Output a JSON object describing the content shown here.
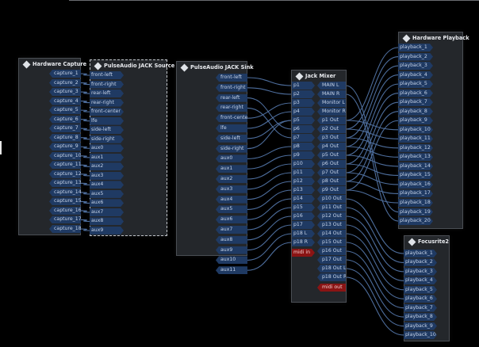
{
  "colors": {
    "port": "#1f3a63",
    "midi_port": "#8a1414",
    "wire": "#4d6d9c",
    "box_bg": "#24272b"
  },
  "boxes": [
    {
      "id": "hwcap",
      "title": "Hardware Capture",
      "icon": "diamond-icon",
      "dashed": false,
      "outs": [
        "capture_1",
        "capture_2",
        "capture_3",
        "capture_4",
        "capture_5",
        "capture_6",
        "capture_7",
        "capture_8",
        "capture_9",
        "capture_10",
        "capture_11",
        "capture_12",
        "capture_13",
        "capture_14",
        "capture_15",
        "capture_16",
        "capture_17",
        "capture_18"
      ],
      "ins": []
    },
    {
      "id": "pasrc",
      "title": "PulseAudio JACK Source",
      "icon": "diamond-icon",
      "dashed": true,
      "ins": [
        "front-left",
        "front-right",
        "rear-left",
        "rear-right",
        "front-center",
        "lfe",
        "side-left",
        "side-right",
        "aux0",
        "aux1",
        "aux2",
        "aux3",
        "aux4",
        "aux5",
        "aux6",
        "aux7",
        "aux8",
        "aux9"
      ],
      "outs": []
    },
    {
      "id": "pasink",
      "title": "PulseAudio JACK Sink",
      "icon": "diamond-icon",
      "dashed": false,
      "ins": [],
      "outs": [
        "front-left",
        "front-right",
        "rear-left",
        "rear-right",
        "front-center",
        "lfe",
        "side-left",
        "side-right",
        "aux0",
        "aux1",
        "aux2",
        "aux3",
        "aux4",
        "aux5",
        "aux6",
        "aux7",
        "aux8",
        "aux9",
        "aux10",
        "aux11"
      ]
    },
    {
      "id": "mixer",
      "title": "Jack Mixer",
      "icon": "diamond-icon",
      "dashed": false,
      "ins": [
        "p1",
        "p2",
        "p3",
        "p4",
        "p5",
        "p6",
        "p7",
        "p8",
        "p9",
        "p10",
        "p11",
        "p12",
        "p13",
        "p14",
        "p15",
        "p16",
        "p17",
        "p18 L",
        "p18 R",
        "midi in"
      ],
      "outs": [
        "MAIN L",
        "MAIN R",
        "Monitor L",
        "Monitor R",
        "p1 Out",
        "p2 Out",
        "p3 Out",
        "p4 Out",
        "p5 Out",
        "p6 Out",
        "p7 Out",
        "p8 Out",
        "p9 Out",
        "p10 Out",
        "p11 Out",
        "p12 Out",
        "p13 Out",
        "p14 Out",
        "p15 Out",
        "p16 Out",
        "p17 Out",
        "p18 Out L",
        "p18 Out R",
        "midi out"
      ]
    },
    {
      "id": "hwplay",
      "title": "Hardware Playback",
      "icon": "diamond-icon",
      "dashed": false,
      "ins": [
        "playback_1",
        "playback_2",
        "playback_3",
        "playback_4",
        "playback_5",
        "playback_6",
        "playback_7",
        "playback_8",
        "playback_9",
        "playback_10",
        "playback_11",
        "playback_12",
        "playback_13",
        "playback_14",
        "playback_15",
        "playback_16",
        "playback_17",
        "playback_18",
        "playback_19",
        "playback_20"
      ],
      "outs": []
    },
    {
      "id": "focus",
      "title": "Focusrite2",
      "icon": "diamond-icon",
      "dashed": false,
      "ins": [
        "playback_1",
        "playback_2",
        "playback_3",
        "playback_4",
        "playback_5",
        "playback_6",
        "playback_7",
        "playback_8",
        "playback_9",
        "playback_10"
      ],
      "outs": []
    }
  ],
  "connections": [
    [
      "hwcap",
      0,
      "pasrc",
      0
    ],
    [
      "hwcap",
      1,
      "pasrc",
      1
    ],
    [
      "hwcap",
      2,
      "pasrc",
      2
    ],
    [
      "hwcap",
      3,
      "pasrc",
      3
    ],
    [
      "hwcap",
      4,
      "pasrc",
      4
    ],
    [
      "hwcap",
      5,
      "pasrc",
      5
    ],
    [
      "hwcap",
      6,
      "pasrc",
      6
    ],
    [
      "hwcap",
      7,
      "pasrc",
      7
    ],
    [
      "hwcap",
      8,
      "pasrc",
      8
    ],
    [
      "hwcap",
      9,
      "pasrc",
      9
    ],
    [
      "hwcap",
      10,
      "pasrc",
      10
    ],
    [
      "hwcap",
      11,
      "pasrc",
      11
    ],
    [
      "hwcap",
      12,
      "pasrc",
      12
    ],
    [
      "hwcap",
      13,
      "pasrc",
      13
    ],
    [
      "hwcap",
      14,
      "pasrc",
      14
    ],
    [
      "hwcap",
      15,
      "pasrc",
      15
    ],
    [
      "hwcap",
      16,
      "pasrc",
      16
    ],
    [
      "hwcap",
      17,
      "pasrc",
      17
    ],
    [
      "pasink",
      0,
      "mixer",
      0
    ],
    [
      "pasink",
      1,
      "mixer",
      1
    ],
    [
      "pasink",
      2,
      "mixer",
      5
    ],
    [
      "pasink",
      3,
      "mixer",
      6
    ],
    [
      "pasink",
      4,
      "mixer",
      2
    ],
    [
      "pasink",
      5,
      "mixer",
      3
    ],
    [
      "pasink",
      6,
      "mixer",
      4
    ],
    [
      "pasink",
      7,
      "mixer",
      4
    ],
    [
      "pasink",
      8,
      "mixer",
      7
    ],
    [
      "pasink",
      9,
      "mixer",
      8
    ],
    [
      "pasink",
      10,
      "mixer",
      9
    ],
    [
      "pasink",
      11,
      "mixer",
      10
    ],
    [
      "pasink",
      12,
      "mixer",
      11
    ],
    [
      "pasink",
      13,
      "mixer",
      12
    ],
    [
      "pasink",
      14,
      "mixer",
      13
    ],
    [
      "pasink",
      15,
      "mixer",
      14
    ],
    [
      "pasink",
      16,
      "mixer",
      15
    ],
    [
      "pasink",
      17,
      "mixer",
      16
    ],
    [
      "pasink",
      18,
      "mixer",
      17
    ],
    [
      "pasink",
      19,
      "mixer",
      18
    ],
    [
      "mixer",
      4,
      "hwplay",
      0
    ],
    [
      "mixer",
      5,
      "hwplay",
      1
    ],
    [
      "mixer",
      6,
      "hwplay",
      2
    ],
    [
      "mixer",
      7,
      "hwplay",
      3
    ],
    [
      "mixer",
      8,
      "hwplay",
      4
    ],
    [
      "mixer",
      9,
      "hwplay",
      5
    ],
    [
      "mixer",
      10,
      "hwplay",
      6
    ],
    [
      "mixer",
      11,
      "hwplay",
      7
    ],
    [
      "mixer",
      12,
      "hwplay",
      8
    ],
    [
      "mixer",
      4,
      "hwplay",
      9
    ],
    [
      "mixer",
      5,
      "hwplay",
      10
    ],
    [
      "mixer",
      6,
      "hwplay",
      11
    ],
    [
      "mixer",
      7,
      "hwplay",
      12
    ],
    [
      "mixer",
      8,
      "hwplay",
      13
    ],
    [
      "mixer",
      9,
      "hwplay",
      14
    ],
    [
      "mixer",
      10,
      "hwplay",
      15
    ],
    [
      "mixer",
      11,
      "hwplay",
      16
    ],
    [
      "mixer",
      12,
      "hwplay",
      17
    ],
    [
      "mixer",
      0,
      "hwplay",
      18
    ],
    [
      "mixer",
      1,
      "hwplay",
      19
    ],
    [
      "mixer",
      13,
      "focus",
      0
    ],
    [
      "mixer",
      14,
      "focus",
      1
    ],
    [
      "mixer",
      15,
      "focus",
      2
    ],
    [
      "mixer",
      16,
      "focus",
      3
    ],
    [
      "mixer",
      17,
      "focus",
      4
    ],
    [
      "mixer",
      18,
      "focus",
      5
    ],
    [
      "mixer",
      19,
      "focus",
      6
    ],
    [
      "mixer",
      20,
      "focus",
      7
    ],
    [
      "mixer",
      21,
      "focus",
      8
    ],
    [
      "mixer",
      22,
      "focus",
      9
    ]
  ]
}
